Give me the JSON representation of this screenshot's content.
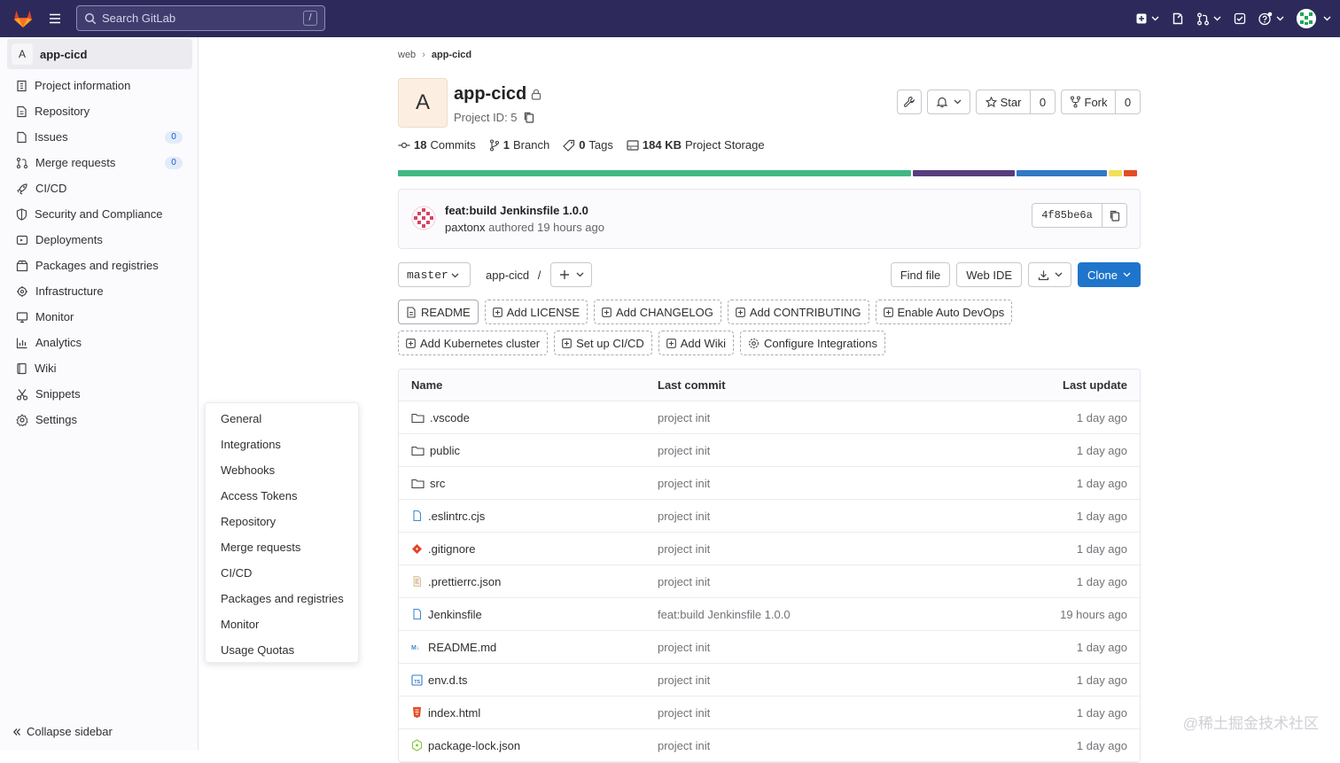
{
  "topbar": {
    "search_placeholder": "Search GitLab",
    "search_shortcut": "/"
  },
  "sidebar": {
    "project_initial": "A",
    "project_name": "app-cicd",
    "items": [
      {
        "label": "Project information",
        "icon": "info-icon"
      },
      {
        "label": "Repository",
        "icon": "doc-icon"
      },
      {
        "label": "Issues",
        "icon": "issues-icon",
        "badge": "0"
      },
      {
        "label": "Merge requests",
        "icon": "merge-icon",
        "badge": "0"
      },
      {
        "label": "CI/CD",
        "icon": "rocket-icon"
      },
      {
        "label": "Security and Compliance",
        "icon": "shield-icon"
      },
      {
        "label": "Deployments",
        "icon": "deploy-icon"
      },
      {
        "label": "Packages and registries",
        "icon": "package-icon"
      },
      {
        "label": "Infrastructure",
        "icon": "cloud-gear-icon"
      },
      {
        "label": "Monitor",
        "icon": "monitor-icon"
      },
      {
        "label": "Analytics",
        "icon": "chart-icon"
      },
      {
        "label": "Wiki",
        "icon": "book-icon"
      },
      {
        "label": "Snippets",
        "icon": "scissors-icon"
      },
      {
        "label": "Settings",
        "icon": "gear-icon"
      }
    ],
    "collapse_label": "Collapse sidebar"
  },
  "settings_flyout": [
    "General",
    "Integrations",
    "Webhooks",
    "Access Tokens",
    "Repository",
    "Merge requests",
    "CI/CD",
    "Packages and registries",
    "Monitor",
    "Usage Quotas"
  ],
  "breadcrumb": {
    "parent": "web",
    "current": "app-cicd"
  },
  "project": {
    "initial": "A",
    "name": "app-cicd",
    "id_label": "Project ID: 5",
    "star_label": "Star",
    "star_count": "0",
    "fork_label": "Fork",
    "fork_count": "0"
  },
  "stats": {
    "commits_num": "18",
    "commits_label": "Commits",
    "branch_num": "1",
    "branch_label": "Branch",
    "tags_num": "0",
    "tags_label": "Tags",
    "storage_num": "184 KB",
    "storage_label": "Project Storage"
  },
  "language_bar": [
    {
      "share": 0.697,
      "color": "#41b883"
    },
    {
      "share": 0.139,
      "color": "#563d7c"
    },
    {
      "share": 0.123,
      "color": "#3178c6"
    },
    {
      "share": 0.018,
      "color": "#f1e05a"
    },
    {
      "share": 0.018,
      "color": "#e34c26"
    }
  ],
  "last_commit": {
    "message": "feat:build Jenkinsfile 1.0.0",
    "author": "paxtonx",
    "meta": "authored 19 hours ago",
    "sha": "4f85be6a"
  },
  "toolbar": {
    "branch": "master",
    "path": "app-cicd",
    "path_sep": "/",
    "find_file": "Find file",
    "web_ide": "Web IDE",
    "clone": "Clone"
  },
  "quick_actions_row1": [
    "README",
    "Add LICENSE",
    "Add CHANGELOG",
    "Add CONTRIBUTING",
    "Enable Auto DevOps"
  ],
  "quick_actions_row2": [
    "Add Kubernetes cluster",
    "Set up CI/CD",
    "Add Wiki",
    "Configure Integrations"
  ],
  "file_table": {
    "headers": {
      "name": "Name",
      "commit": "Last commit",
      "update": "Last update"
    },
    "rows": [
      {
        "name": ".vscode",
        "icon": "folder-icon",
        "commit": "project init",
        "update": "1 day ago"
      },
      {
        "name": "public",
        "icon": "folder-icon",
        "commit": "project init",
        "update": "1 day ago"
      },
      {
        "name": "src",
        "icon": "folder-icon",
        "commit": "project init",
        "update": "1 day ago"
      },
      {
        "name": ".eslintrc.cjs",
        "icon": "file-icon",
        "commit": "project init",
        "update": "1 day ago"
      },
      {
        "name": ".gitignore",
        "icon": "git-icon",
        "commit": "project init",
        "update": "1 day ago"
      },
      {
        "name": ".prettierrc.json",
        "icon": "prettier-icon",
        "commit": "project init",
        "update": "1 day ago"
      },
      {
        "name": "Jenkinsfile",
        "icon": "file-icon",
        "commit": "feat:build Jenkinsfile 1.0.0",
        "update": "19 hours ago"
      },
      {
        "name": "README.md",
        "icon": "markdown-icon",
        "commit": "project init",
        "update": "1 day ago"
      },
      {
        "name": "env.d.ts",
        "icon": "ts-icon",
        "commit": "project init",
        "update": "1 day ago"
      },
      {
        "name": "index.html",
        "icon": "html-icon",
        "commit": "project init",
        "update": "1 day ago"
      },
      {
        "name": "package-lock.json",
        "icon": "npm-icon",
        "commit": "project init",
        "update": "1 day ago"
      }
    ]
  },
  "watermark": "@稀土掘金技术社区"
}
